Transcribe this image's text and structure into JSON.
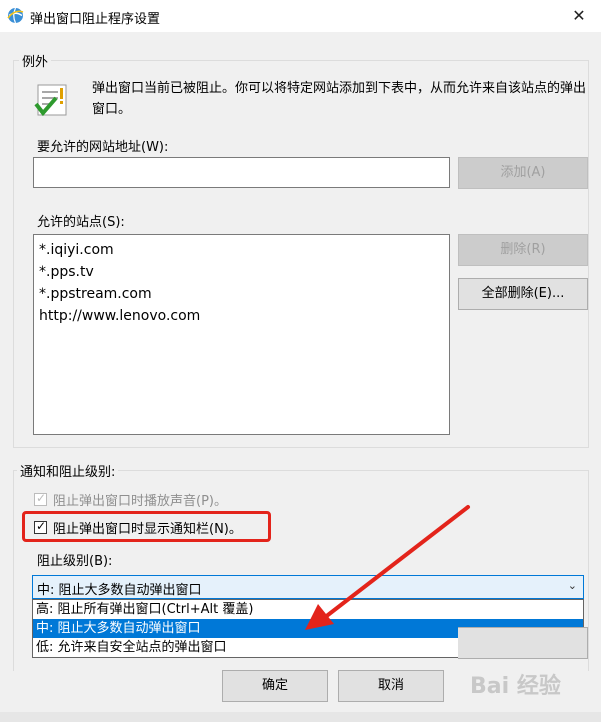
{
  "window": {
    "title": "弹出窗口阻止程序设置",
    "close_glyph": "✕"
  },
  "exceptions": {
    "legend": "例外",
    "info": "弹出窗口当前已被阻止。你可以将特定网站添加到下表中，从而允许来自该站点的弹出窗口。",
    "address_label": "要允许的网站地址(W):",
    "address_value": "",
    "add_button": "添加(A)",
    "allowed_label": "允许的站点(S):",
    "allowed_sites": [
      "*.iqiyi.com",
      "*.pps.tv",
      "*.ppstream.com",
      "http://www.lenovo.com"
    ],
    "remove_button": "删除(R)",
    "remove_all_button": "全部删除(E)..."
  },
  "notifications": {
    "legend": "通知和阻止级别:",
    "play_sound_label": "阻止弹出窗口时播放声音(P)。",
    "show_bar_label": "阻止弹出窗口时显示通知栏(N)。",
    "blocking_level_label": "阻止级别(B):",
    "blocking_level_selected": "中: 阻止大多数自动弹出窗口",
    "blocking_level_options": [
      "高: 阻止所有弹出窗口(Ctrl+Alt 覆盖)",
      "中: 阻止大多数自动弹出窗口",
      "低: 允许来自安全站点的弹出窗口"
    ]
  },
  "footer": {
    "ok_button": "确定",
    "cancel_button": "取消"
  },
  "watermark": "Bai 经验",
  "colors": {
    "accent": "#0078d7",
    "annotation_red": "#e3241b"
  },
  "icons": {
    "title": "ie-globe-icon",
    "info": "checklist-warning-icon",
    "combo": "chevron-down-icon"
  }
}
